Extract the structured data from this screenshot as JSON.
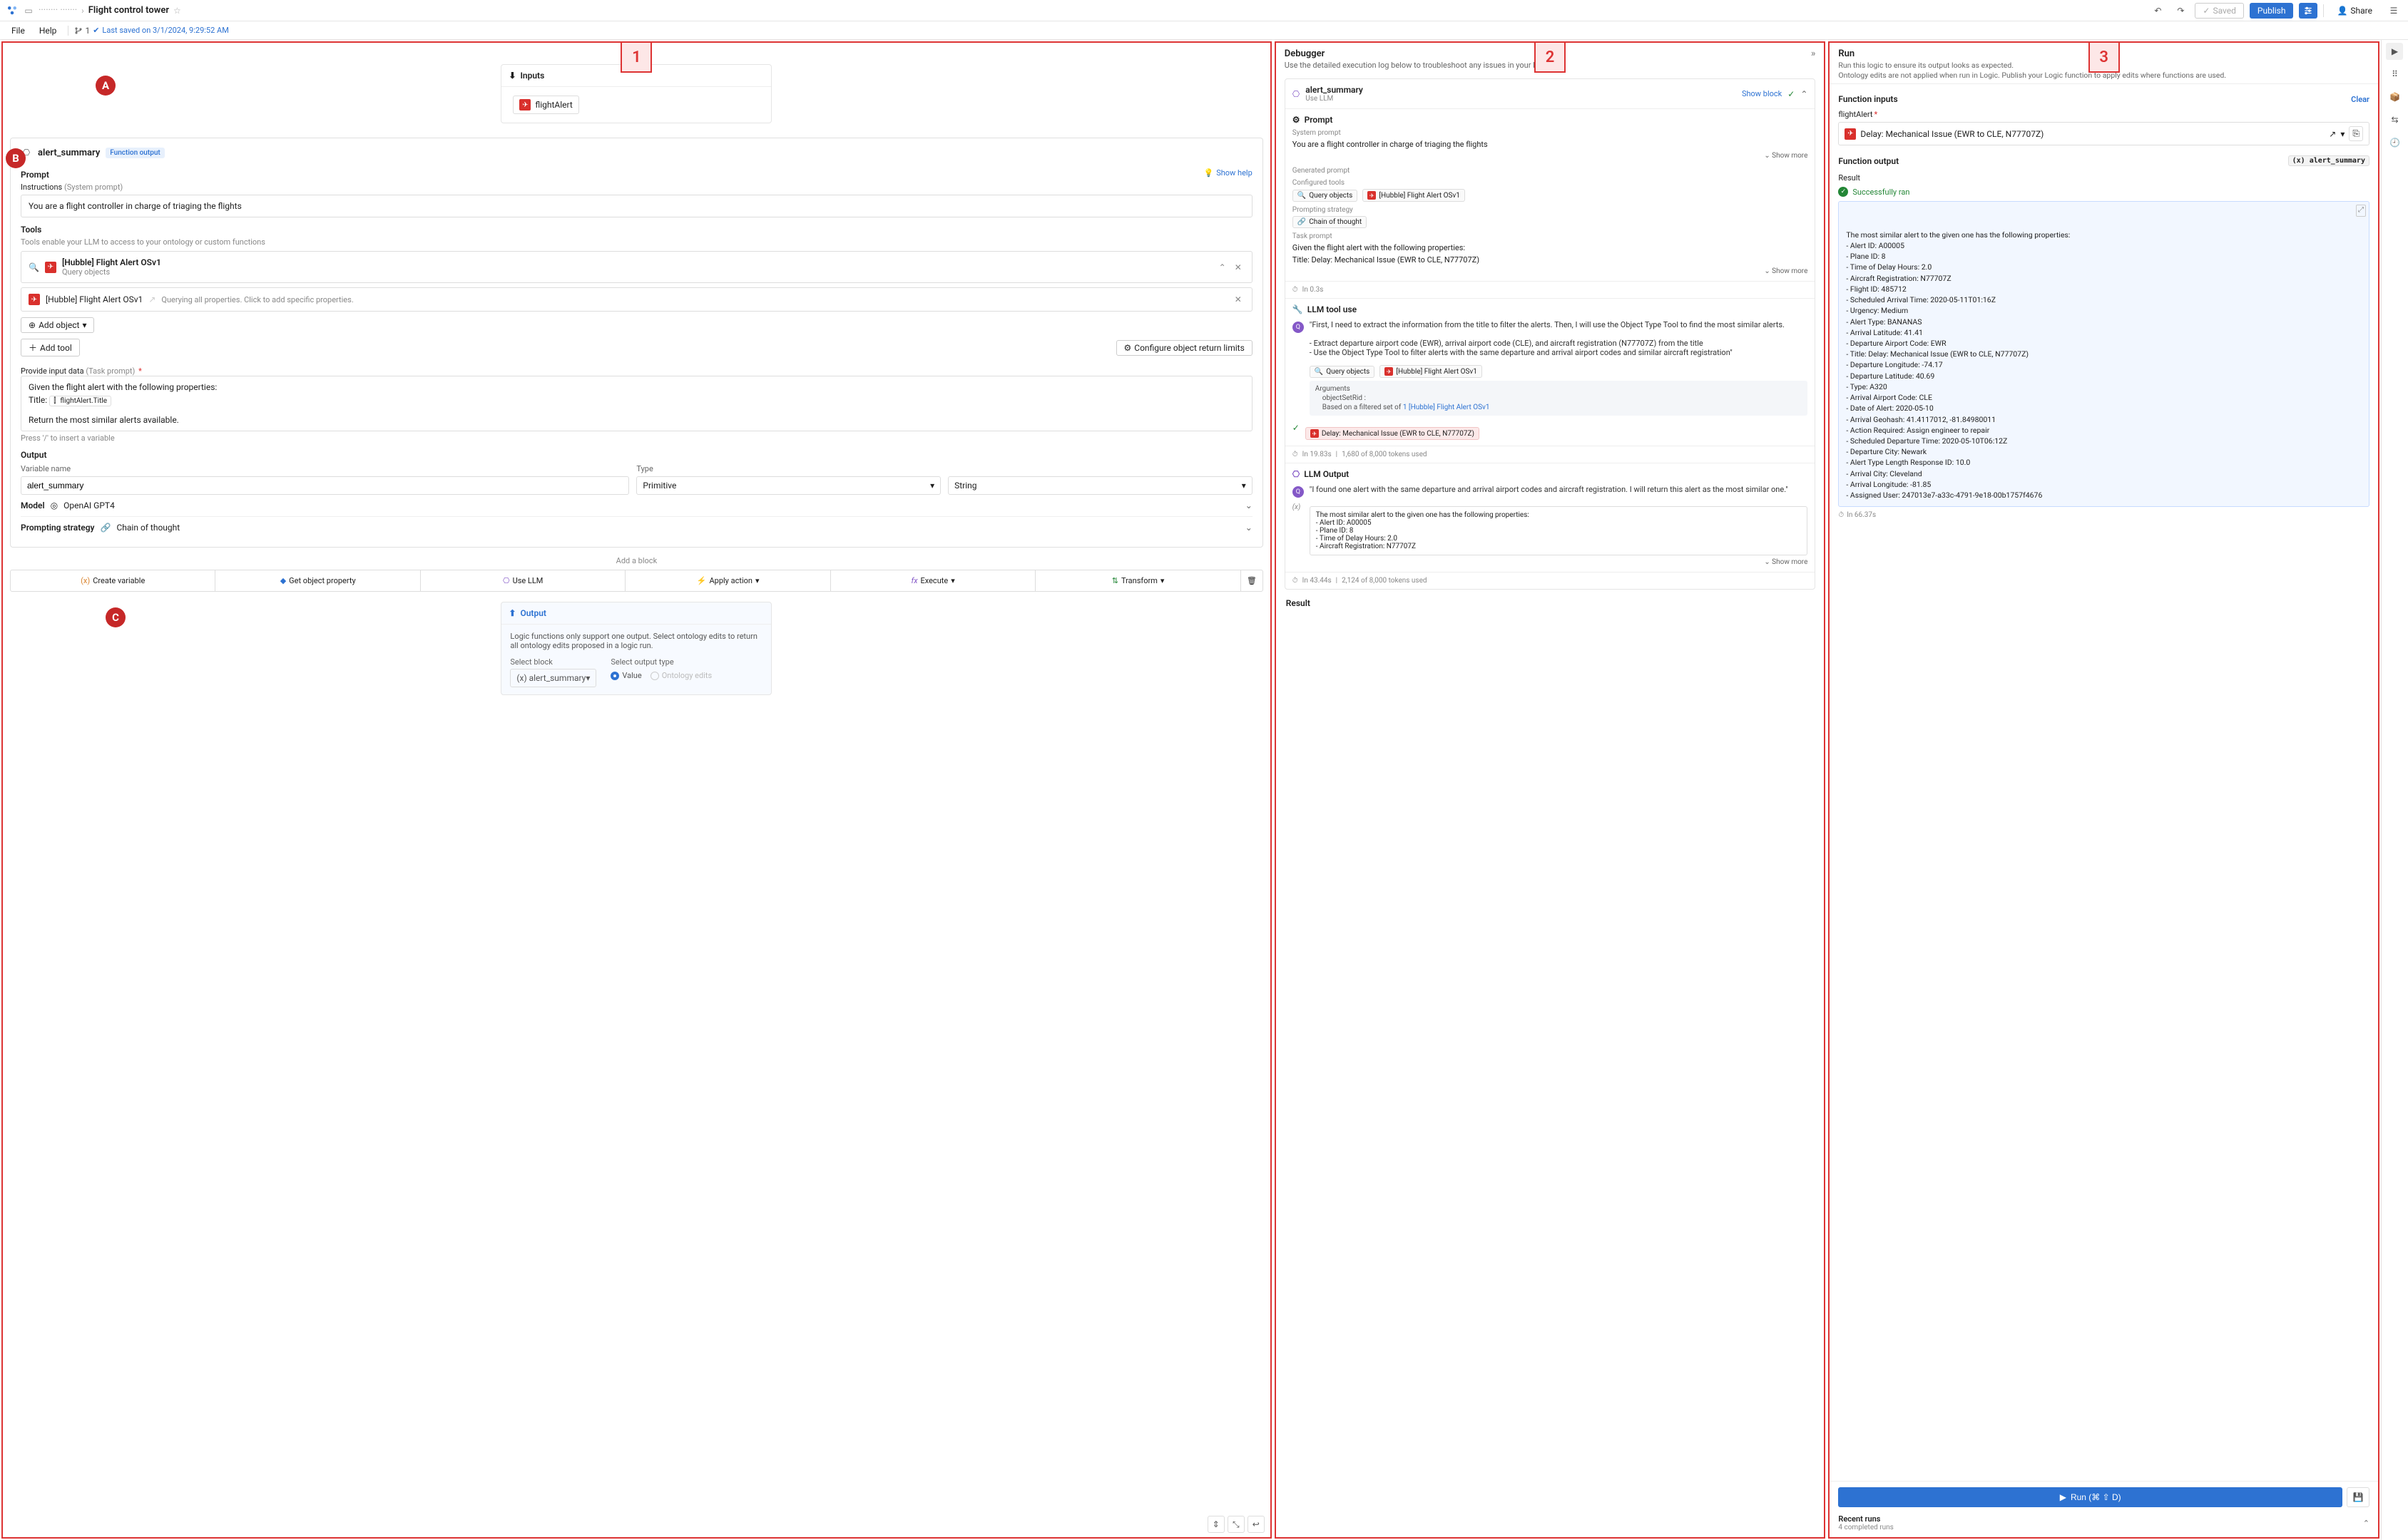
{
  "topbar": {
    "breadcrumb_parent": "········ ·······",
    "breadcrumb_title": "Flight control tower",
    "file_menu": "File",
    "help_menu": "Help",
    "branch_count": "1",
    "saved_text": "Last saved on 3/1/2024, 9:29:52 AM",
    "saved_btn": "Saved",
    "publish_btn": "Publish",
    "share_btn": "Share"
  },
  "badges": {
    "n1": "1",
    "n2": "2",
    "n3": "3",
    "A": "A",
    "B": "B",
    "C": "C"
  },
  "panel1": {
    "inputs_title": "Inputs",
    "input_var": "flightAlert",
    "block_name": "alert_summary",
    "fn_output_tag": "Function output",
    "prompt_title": "Prompt",
    "show_help": "Show help",
    "instructions_label": "Instructions",
    "instructions_hint": "(System prompt)",
    "system_prompt_text": "You are a flight controller in charge of triaging the flights",
    "tools_title": "Tools",
    "tools_hint": "Tools enable your LLM to access to your ontology or custom functions",
    "tool_name": "[Hubble] Flight Alert OSv1",
    "tool_sub": "Query objects",
    "tool_query_hint": "Querying all properties. Click to add specific properties.",
    "add_object": "Add object",
    "add_tool": "Add tool",
    "config_limits": "Configure object return limits",
    "task_label": "Provide input data",
    "task_hint": "(Task prompt)",
    "task_line1": "Given the flight alert with the following properties:",
    "task_line2_prefix": "Title:",
    "task_var": "flightAlert.Title",
    "task_line3": "Return the most similar alerts available.",
    "slash_hint": "Press '/' to insert a variable",
    "output_title": "Output",
    "var_name_label": "Variable name",
    "var_name_value": "alert_summary",
    "type_label": "Type",
    "type_primitive": "Primitive",
    "type_string": "String",
    "model_label": "Model",
    "model_value": "OpenAI GPT4",
    "prompting_label": "Prompting strategy",
    "prompting_value": "Chain of thought",
    "add_block": "Add a block",
    "bt_create": "Create variable",
    "bt_getprop": "Get object property",
    "bt_usellm": "Use LLM",
    "bt_apply": "Apply action",
    "bt_execute": "Execute",
    "bt_transform": "Transform",
    "output_card_title": "Output",
    "output_card_desc": "Logic functions only support one output. Select ontology edits to return all ontology edits proposed in a logic run.",
    "select_block_label": "Select block",
    "select_block_value": "alert_summary",
    "select_output_label": "Select output type",
    "radio_value": "Value",
    "radio_ontology": "Ontology edits"
  },
  "panel2": {
    "title": "Debugger",
    "desc": "Use the detailed execution log below to troubleshoot any issues in your Logic.",
    "card_title": "alert_summary",
    "card_sub": "Use LLM",
    "show_block": "Show block",
    "sec_prompt": "Prompt",
    "system_prompt_label": "System prompt",
    "system_prompt_text": "You are a flight controller in charge of triaging the flights",
    "show_more": "Show more",
    "gen_prompt": "Generated prompt",
    "configured_tools": "Configured tools",
    "chip_query": "Query objects",
    "chip_tool": "[Hubble] Flight Alert OSv1",
    "prompting_strategy": "Prompting strategy",
    "chip_chain": "Chain of thought",
    "task_prompt_label": "Task prompt",
    "task_prompt_l1": "Given the flight alert with the following properties:",
    "task_prompt_l2": "Title: Delay: Mechanical Issue (EWR to CLE, N77707Z)",
    "timer1": "In 0.3s",
    "sec_tooluse": "LLM tool use",
    "thought1": "\"First, I need to extract the information from the title to filter the alerts. Then, I will use the Object Type Tool to find the most similar alerts.\n\n- Extract departure airport code (EWR), arrival airport code (CLE), and aircraft registration (N77707Z) from the title\n- Use the Object Type Tool to filter alerts with the same departure and arrival airport codes and similar aircraft registration\"",
    "args_label": "Arguments",
    "args_key": "objectSetRid :",
    "args_text_prefix": "Based on a filtered set of ",
    "args_text_link": "1 [Hubble] Flight Alert OSv1",
    "obs_chip": "Delay: Mechanical Issue (EWR to CLE, N77707Z)",
    "timer2a": "In 19.83s",
    "timer2b": "1,680 of 8,000 tokens used",
    "sec_llmout": "LLM Output",
    "thought2": "\"I found one alert with the same departure and arrival airport codes and aircraft registration. I will return this alert as the most similar one.\"",
    "output_pre": "The most similar alert to the given one has the following properties:\n- Alert ID: A00005\n- Plane ID: 8\n- Time of Delay Hours: 2.0\n- Aircraft Registration: N77707Z",
    "timer3a": "In 43.44s",
    "timer3b": "2,124 of 8,000 tokens used",
    "result_title": "Result"
  },
  "panel3": {
    "title": "Run",
    "desc": "Run this logic to ensure its output looks as expected.\nOntology edits are not applied when run in Logic. Publish your Logic function to apply edits where functions are used.",
    "fn_inputs": "Function inputs",
    "clear": "Clear",
    "input_name": "flightAlert",
    "input_value": "Delay: Mechanical Issue (EWR to CLE, N77707Z)",
    "fn_output": "Function output",
    "fn_output_var": "alert_summary",
    "result_label": "Result",
    "success": "Successfully ran",
    "result_text": "The most similar alert to the given one has the following properties:\n- Alert ID: A00005\n- Plane ID: 8\n- Time of Delay Hours: 2.0\n- Aircraft Registration: N77707Z\n- Flight ID: 485712\n- Scheduled Arrival Time: 2020-05-11T01:16Z\n- Urgency: Medium\n- Alert Type: BANANAS\n- Arrival Latitude: 41.41\n- Departure Airport Code: EWR\n- Title: Delay: Mechanical Issue (EWR to CLE, N77707Z)\n- Departure Longitude: -74.17\n- Departure Latitude: 40.69\n- Type: A320\n- Arrival Airport Code: CLE\n- Date of Alert: 2020-05-10\n- Arrival Geohash: 41.4117012, -81.84980011\n- Action Required: Assign engineer to repair\n- Scheduled Departure Time: 2020-05-10T06:12Z\n- Departure City: Newark\n- Alert Type Length Response ID: 10.0\n- Arrival City: Cleveland\n- Arrival Longitude: -81.85\n- Assigned User: 247013e7-a33c-4791-9e18-00b1757f4676",
    "timer": "In 66.37s",
    "run_btn": "Run (⌘ ⇧ D)",
    "recent_title": "Recent runs",
    "recent_sub": "4 completed runs"
  }
}
